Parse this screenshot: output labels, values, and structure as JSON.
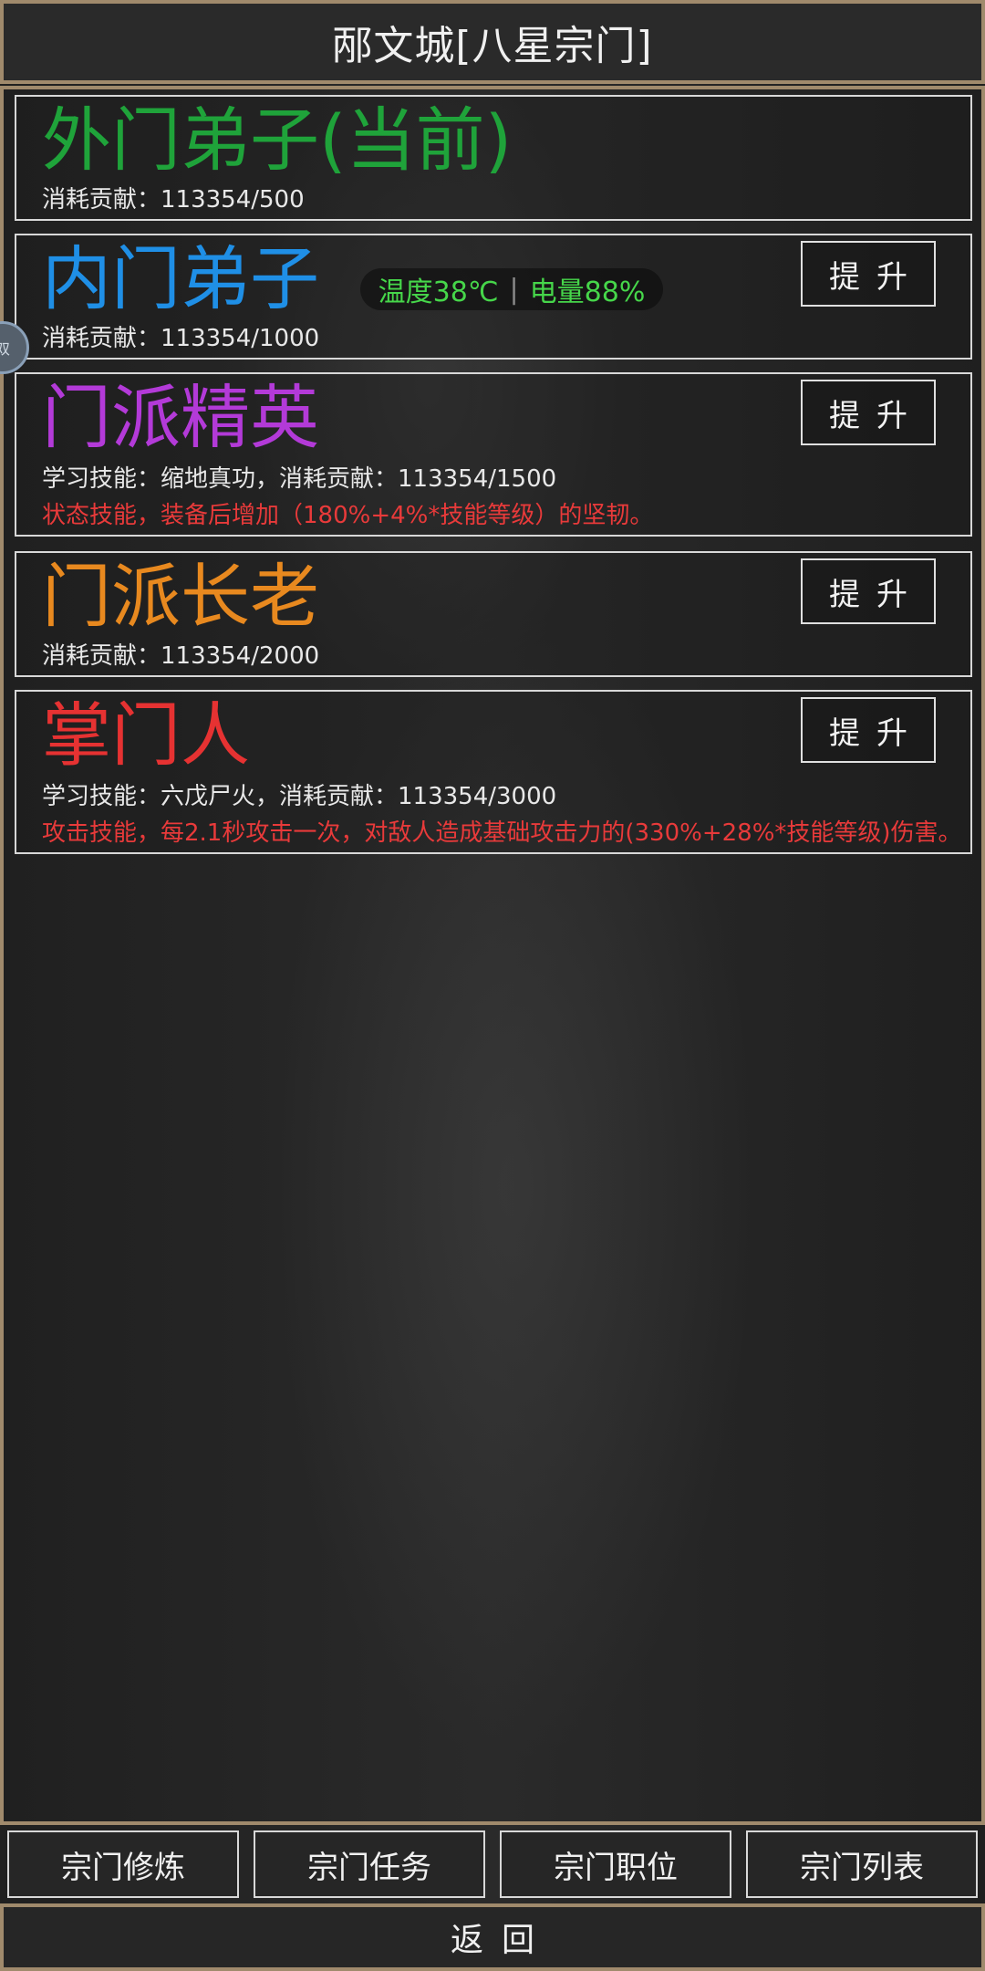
{
  "header": {
    "title": "邴文城[八星宗门]"
  },
  "status": {
    "temperature": "温度38℃",
    "battery": "电量88%"
  },
  "side_ball": {
    "label": "双"
  },
  "ranks": [
    {
      "title": "外门弟子(当前)",
      "color": "#1fa33a",
      "line1": "消耗贡献：113354/500",
      "line2": "",
      "button": ""
    },
    {
      "title": "内门弟子",
      "color": "#1f8fe6",
      "line1": "消耗贡献：113354/1000",
      "line2": "",
      "button": "提升"
    },
    {
      "title": "门派精英",
      "color": "#b33ad8",
      "line1": "学习技能：缩地真功，消耗贡献：113354/1500",
      "line2": "状态技能，装备后增加（180%+4%*技能等级）的坚韧。",
      "button": "提升"
    },
    {
      "title": "门派长老",
      "color": "#e8891f",
      "line1": "消耗贡献：113354/2000",
      "line2": "",
      "button": "提升"
    },
    {
      "title": "掌门人",
      "color": "#e63232",
      "line1": "学习技能：六戊尸火，消耗贡献：113354/3000",
      "line2": "攻击技能，每2.1秒攻击一次，对敌人造成基础攻击力的(330%+28%*技能等级)伤害。",
      "button": "提升"
    }
  ],
  "tabs": [
    "宗门修炼",
    "宗门任务",
    "宗门职位",
    "宗门列表"
  ],
  "footer": {
    "back": "返回"
  }
}
